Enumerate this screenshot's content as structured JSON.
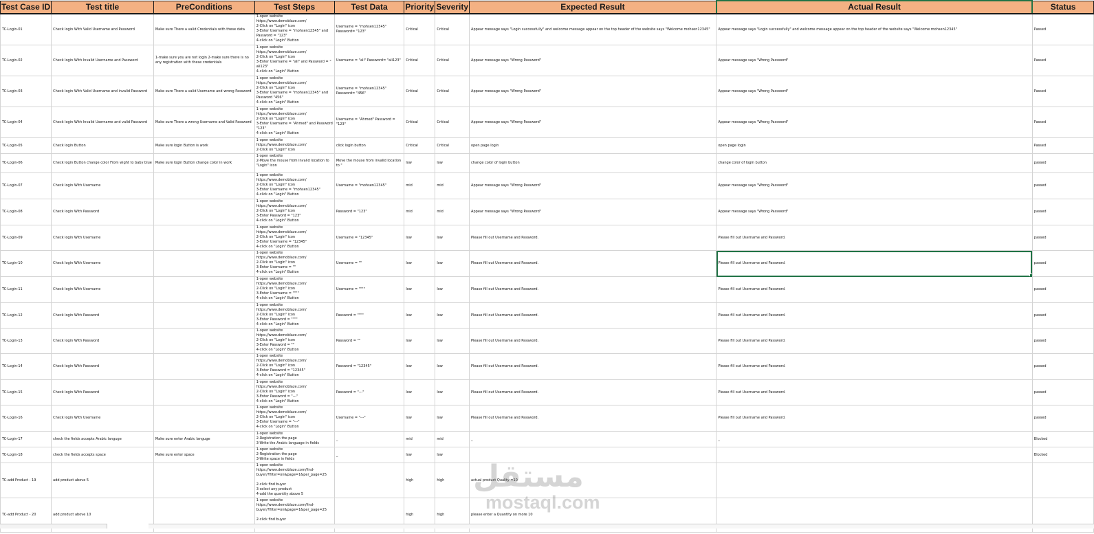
{
  "columns": [
    "Test Case ID",
    "Test title",
    "PreConditions",
    "Test Steps",
    "Test Data",
    "Priority",
    "Severity",
    "Expected Result",
    "Actual Result",
    "Status"
  ],
  "rows": [
    {
      "id": "TC-Login-01",
      "title": "Check login With Valid Username and Password",
      "pre": "Make sure There a valid Credentials with these data",
      "steps": [
        "1-open website",
        "https://www.demoblaze.com/",
        "2-Click on \"Login\" icon",
        "3-Enter Username = \"mohsen12345\" and",
        "Password = \"123\"",
        "4-click on \"Login\" Button"
      ],
      "data": "Username = \"mohsen12345\" Password= \"123\"",
      "priority": "Critical",
      "severity": "Critical",
      "expected": "Appear message says \"Login successfully\" and welcome message appear on the top header of the website says \"Welcome mohsen12345\"",
      "actual": "Appear message says \"Login successfully\" and welcome message appear on the top header of the website says \"Welcome mohsen12345\"",
      "status": "Passed"
    },
    {
      "id": "TC-Login-02",
      "title": "Check login With Invalid Username and Password",
      "pre": "1-make sure you are not login 2-make sure there is no any registration with these credentials",
      "steps": [
        "1-open website",
        "https://www.demoblaze.com/",
        "2-Click on \"Login\" icon",
        "3-Enter Username = \"ali\" and Password = \"",
        "ali123\"",
        "4-click on \"Login\" Button"
      ],
      "data": "Username = \"ali\" Password= \"ali123\"",
      "priority": "Critical",
      "severity": "Critical",
      "expected": "Appear message says \"Wrong Password\"",
      "actual": "Appear message says \"Wrong Password\"",
      "status": "Passed"
    },
    {
      "id": "TC-Login-03",
      "title": "Check login With Valid Username and invalid Password",
      "pre": "Make sure There a valid Username and wrong Password",
      "steps": [
        "1-open website",
        "https://www.demoblaze.com/",
        "2-Click on \"Login\" icon",
        "3-Enter Username = \"mohsen12345\" and",
        "Password \"456\"",
        "4-click on \"Login\" Button"
      ],
      "data": "Username = \"mohsen12345\" Password= \"456\"",
      "priority": "Critical",
      "severity": "Critical",
      "expected": "Appear message says \"Wrong Password\"",
      "actual": "Appear message says \"Wrong Password\"",
      "status": "Passed"
    },
    {
      "id": "TC-Login-04",
      "title": "Check login With Invalid Username and valid Password",
      "pre": "Make sure There a wrong Username and Valid Password",
      "steps": [
        "1-open website",
        "https://www.demoblaze.com/",
        "2-Click on \"Login\" icon",
        "3-Enter Username = \"Ahmed\" and Password",
        "\"123\"",
        "4-click on \"Login\" Button"
      ],
      "data": "Username = \"Ahmed\" Password = \"123\"",
      "priority": "Critical",
      "severity": "Critical",
      "expected": "Appear message says \"Wrong Password\"",
      "actual": "Appear message says \"Wrong Password\"",
      "status": "Passed"
    },
    {
      "id": "TC-Login-05",
      "title": "Check login Button",
      "pre": "Make sure login Button is work",
      "steps": [
        "1-open website",
        "https://www.demoblaze.com/",
        "2-Click on \"Login\" icon"
      ],
      "data": "click login button",
      "priority": "Critical",
      "severity": "Critical",
      "expected": "open page login",
      "actual": "open page login",
      "status": "Passed"
    },
    {
      "id": "TC-Login-06",
      "title": "Check login Button change color From wight to baby blue",
      "pre": "Make sure login Button change color in work",
      "steps": [
        "1-open website",
        "2-Move the mouse from invalid location to",
        "\"Login\" icon"
      ],
      "data": "Move the mouse from invalid location to \"",
      "priority": "low",
      "severity": "low",
      "expected": "change color of login button",
      "actual": "change color of login button",
      "status": "passed"
    },
    {
      "id": "TC-Login-07",
      "title": "Check login With Username",
      "pre": "",
      "steps": [
        "1-open website",
        "https://www.demoblaze.com/",
        "2-Click on \"Login\" icon",
        "3-Enter Username = \"mohsen12345\"",
        "4-click on \"Login\" Button"
      ],
      "data": "Username = \"mohsen12345\"",
      "priority": "mid",
      "severity": "mid",
      "expected": "Appear message says \"Wrong Password\"",
      "actual": "Appear message says \"Wrong Password\"",
      "status": "passed"
    },
    {
      "id": "TC-Login-08",
      "title": "Check login With Password",
      "pre": "",
      "steps": [
        "1-open website",
        "https://www.demoblaze.com/",
        "2-Click on \"Login\" icon",
        "3-Enter Password = \"123\"",
        "4-click on \"Login\" Button"
      ],
      "data": "Password = \"123\"",
      "priority": "mid",
      "severity": "mid",
      "expected": "Appear message says \"Wrong Password\"",
      "actual": "Appear message says \"Wrong Password\"",
      "status": "passed"
    },
    {
      "id": "TC-Login-09",
      "title": "Check login With Username",
      "pre": "",
      "steps": [
        "1-open website",
        "https://www.demoblaze.com/",
        "2-Click on \"Login\" icon",
        "3-Enter Username = \"12345\"",
        "4-click on \"Login\" Button"
      ],
      "data": "Username = \"12345\"",
      "priority": "low",
      "severity": "low",
      "expected": "Please fill out Username and Password.",
      "actual": "Please fill out Username and Password.",
      "status": "passed"
    },
    {
      "id": "TC-Login-10",
      "title": "Check login With Username",
      "pre": "",
      "steps": [
        "1-open website",
        "https://www.demoblaze.com/",
        "2-Click on \"Login\" icon",
        "3-Enter Username = \"\"",
        "4-click on \"Login\" Button"
      ],
      "data": "Username = \"\"",
      "priority": "low",
      "severity": "low",
      "expected": "Please fill out Username and Password.",
      "actual": "Please fill out Username and Password.",
      "status": "passed"
    },
    {
      "id": "TC-Login-11",
      "title": "Check login With Username",
      "pre": "",
      "steps": [
        "1-open website",
        "https://www.demoblaze.com/",
        "2-Click on \"Login\" icon",
        "3-Enter Username = \"\"\"\"",
        "4-click on \"Login\" Button"
      ],
      "data": "Username = \"\"\"\"",
      "priority": "low",
      "severity": "low",
      "expected": "Please fill out Username and Password.",
      "actual": "Please fill out Username and Password.",
      "status": "passed"
    },
    {
      "id": "TC-Login-12",
      "title": "Check login With Password",
      "pre": "",
      "steps": [
        "1-open website",
        "https://www.demoblaze.com/",
        "2-Click on \"Login\" icon",
        "3-Enter Password = \"\"\"\"",
        "4-click on \"Login\" Button"
      ],
      "data": "Password = \"\"\"\"",
      "priority": "low",
      "severity": "low",
      "expected": "Please fill out Username and Password.",
      "actual": "Please fill out Username and Password.",
      "status": "passed"
    },
    {
      "id": "TC-Login-13",
      "title": "Check login With Password",
      "pre": "",
      "steps": [
        "1-open website",
        "https://www.demoblaze.com/",
        "2-Click on \"Login\" icon",
        "3-Enter Password = \"\"",
        "4-click on \"Login\" Button"
      ],
      "data": "Password = \"\"",
      "priority": "low",
      "severity": "low",
      "expected": "Please fill out Username and Password.",
      "actual": "Please fill out Username and Password.",
      "status": "passed"
    },
    {
      "id": "TC-Login-14",
      "title": "Check login With Password",
      "pre": "",
      "steps": [
        "1-open website",
        "https://www.demoblaze.com/",
        "2-Click on \"Login\" icon",
        "3-Enter Password = \"12345\"",
        "4-click on \"Login\" Button"
      ],
      "data": "Password = \"12345\"",
      "priority": "low",
      "severity": "low",
      "expected": "Please fill out Username and Password.",
      "actual": "Please fill out Username and Password.",
      "status": "passed"
    },
    {
      "id": "TC-Login-15",
      "title": "Check login With Password",
      "pre": "",
      "steps": [
        "1-open website",
        "https://www.demoblaze.com/",
        "2-Click on \"Login\" icon",
        "3-Enter Password = \"---\"",
        "4-click on \"Login\" Button"
      ],
      "data": "Password = \"---\"",
      "priority": "low",
      "severity": "low",
      "expected": "Please fill out Username and Password.",
      "actual": "Please fill out Username and Password.",
      "status": "passed"
    },
    {
      "id": "TC-Login-16",
      "title": "Check login With Username",
      "pre": "",
      "steps": [
        "1-open website",
        "https://www.demoblaze.com/",
        "2-Click on \"Login\" icon",
        "3-Enter Username = \"---\"",
        "4-click on \"Login\" Button"
      ],
      "data": "Username = \"---\"",
      "priority": "low",
      "severity": "low",
      "expected": "Please fill out Username and Password.",
      "actual": "Please fill out Username and Password.",
      "status": "passed"
    },
    {
      "id": "TC-Login-17",
      "title": "check the fields accepts Arabic languge",
      "pre": "Make sure enter Arabic languge",
      "steps": [
        "1-open website",
        "2-Registration the page",
        "3-Write the Arabic language in fields"
      ],
      "data": "_",
      "priority": "mid",
      "severity": "mid",
      "expected": "_",
      "actual": "_",
      "status": "Blocked"
    },
    {
      "id": "TC-Login-18",
      "title": "check the fields accepts space",
      "pre": "Make sure enter space",
      "steps": [
        "1-open website",
        "2-Registration the page",
        "3-Write space in fields"
      ],
      "data": "_",
      "priority": "low",
      "severity": "low",
      "expected": "",
      "actual": "",
      "status": "Blocked"
    },
    {
      "id": "TC-add Product - 19",
      "title": "add product above 5",
      "pre": "",
      "steps": [
        "1-open website",
        "https://www.demoblaze.com/find-",
        "buyer/?filter=on&page=1&per_page=25",
        "",
        "2-click find buyer",
        "3-select any product",
        "4-add the quantity above 5"
      ],
      "data": "",
      "priority": "high",
      "severity": "high",
      "expected": "actual product Quality =10",
      "actual": "",
      "status": ""
    },
    {
      "id": "TC-add Product - 20",
      "title": "add product above 10",
      "pre": "",
      "steps": [
        "1-open website",
        "https://www.demoblaze.com/find-",
        "buyer/?filter=on&page=1&per_page=25",
        "",
        "2-click find buyer"
      ],
      "data": "",
      "priority": "high",
      "severity": "high",
      "expected": "please enter a Quantity on more 10",
      "actual": "",
      "status": ""
    }
  ],
  "selected_cell": {
    "row": 9,
    "column": "Actual Result"
  },
  "watermark": {
    "arabic": "مستقل",
    "latin": "mostaql.com"
  },
  "colors": {
    "header_bg": "#f4b183",
    "selection": "#217346",
    "grid": "#d4d4d4"
  }
}
